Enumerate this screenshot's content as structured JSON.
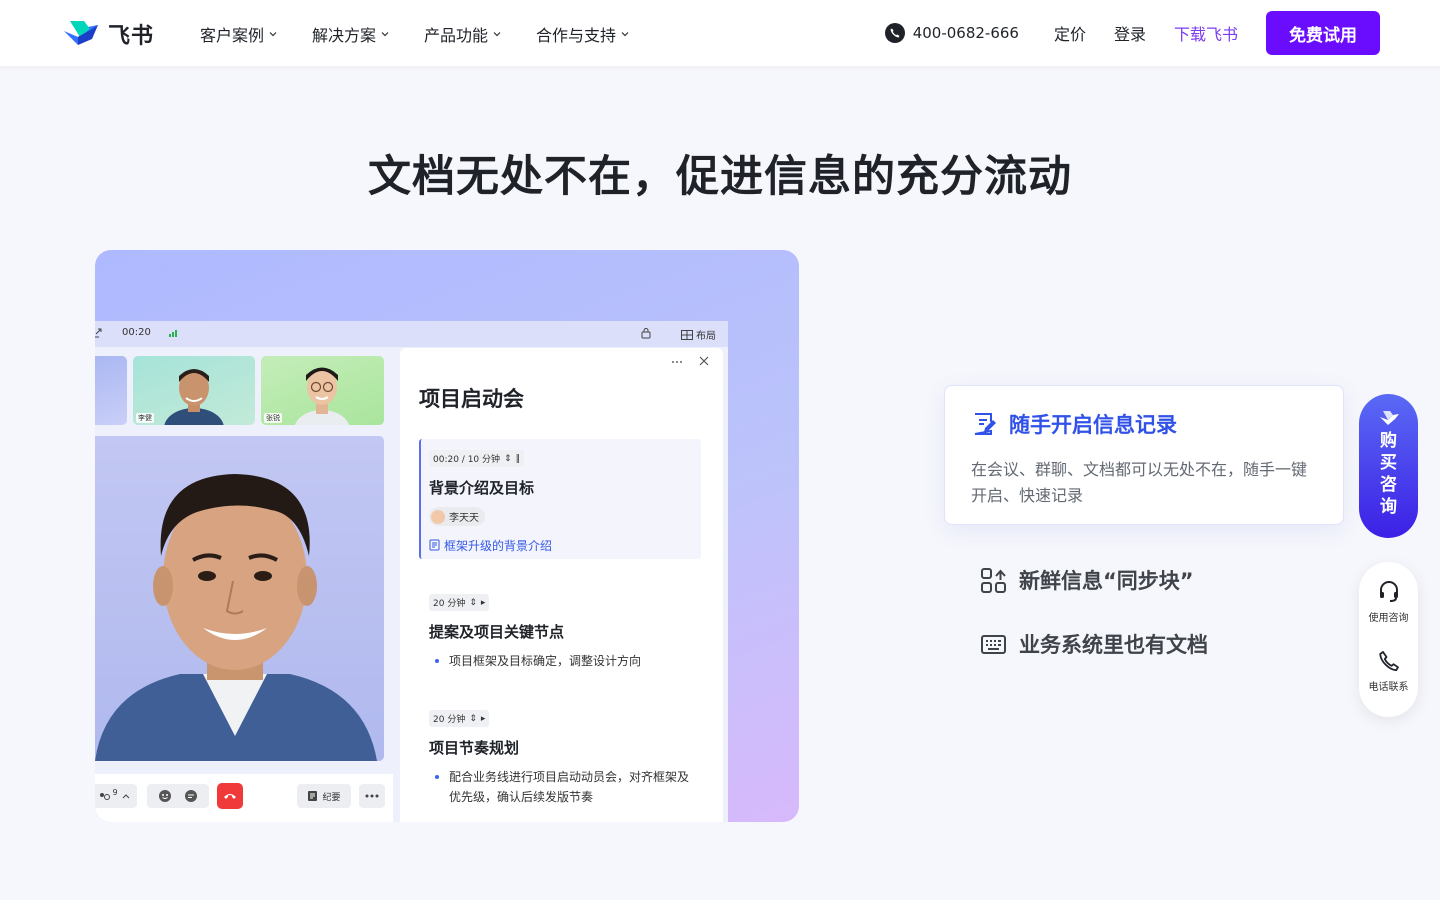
{
  "header": {
    "logo_text": "飞书",
    "nav": [
      "客户案例",
      "解决方案",
      "产品功能",
      "合作与支持"
    ],
    "phone": "400-0682-666",
    "pricing": "定价",
    "login": "登录",
    "download": "下载飞书",
    "trial": "免费试用"
  },
  "headline": "文档无处不在，促进信息的充分流动",
  "meeting": {
    "timer": "00:20",
    "layout_label": "布局",
    "participants": [
      "李健",
      "张锐"
    ],
    "participant_count": "9",
    "notes_label": "纪要",
    "minutes": {
      "title": "项目启动会",
      "items": [
        {
          "time": "00:20 / 10 分钟",
          "title": "背景介绍及目标",
          "owner": "李天天",
          "doc_link": "框架升级的背景介绍"
        },
        {
          "time": "20 分钟",
          "title": "提案及项目关键节点",
          "bullet": "项目框架及目标确定，调整设计方向"
        },
        {
          "time": "20 分钟",
          "title": "项目节奏规划",
          "bullet": "配合业务线进行项目启动动员会，对齐框架及优先级，确认后续发版节奏"
        }
      ]
    }
  },
  "features": {
    "active": {
      "title": "随手开启信息记录",
      "desc": "在会议、群聊、文档都可以无处不在，随手一键开启、快速记录"
    },
    "items": [
      "新鲜信息“同步块”",
      "业务系统里也有文档"
    ]
  },
  "floating": {
    "buy": "购买咨询",
    "usage": "使用咨询",
    "phone": "电话联系"
  },
  "colors": {
    "brand_purple": "#6a0dff",
    "accent_blue": "#3152e8",
    "hangup_red": "#f03a3a"
  }
}
